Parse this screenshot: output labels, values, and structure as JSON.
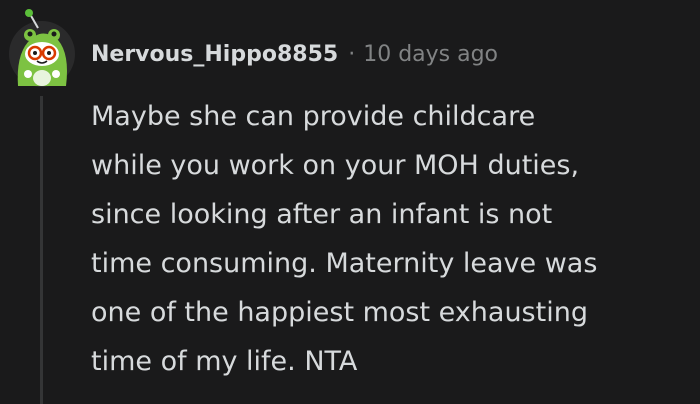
{
  "comment": {
    "author": "Nervous_Hippo8855",
    "separator": "·",
    "timestamp": "10 days ago",
    "lines": [
      "Maybe she can provide childcare",
      "while you work on your MOH duties,",
      "since looking after an infant is not",
      "time consuming. Maternity leave was",
      "one of the happiest most exhausting",
      "time of my life. NTA"
    ]
  },
  "avatar": {
    "icon": "snoo-frog-hood-avatar-icon",
    "colors": {
      "body": "#7dc242",
      "face": "#ffffff",
      "glasses": "#d93a00",
      "background": "#1a1a1b"
    }
  },
  "colors": {
    "background": "#1a1a1b",
    "text": "#d7dadc",
    "muted": "#818384",
    "thread_line": "#343536"
  }
}
